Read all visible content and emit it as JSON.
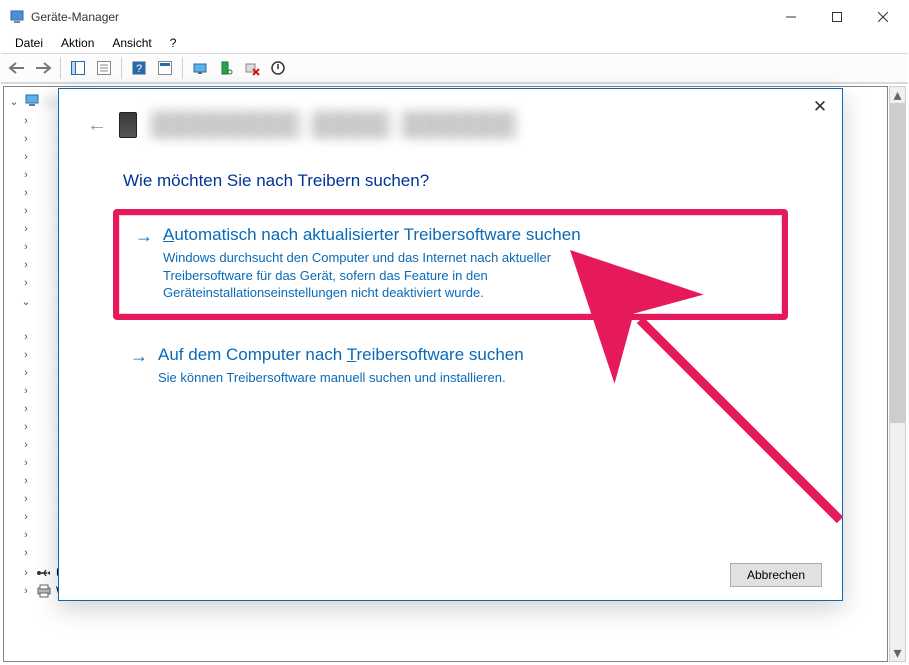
{
  "window": {
    "title": "Geräte-Manager",
    "menus": {
      "file": "Datei",
      "action": "Aktion",
      "view": "Ansicht",
      "help": "?"
    }
  },
  "tree": {
    "root_label": "",
    "visible_rows": [
      {
        "label": "USB-Controller"
      },
      {
        "label": "WSD-Druckanbieter"
      }
    ]
  },
  "dialog": {
    "question": "Wie möchten Sie nach Treibern suchen?",
    "option1": {
      "title_prefix": "A",
      "title_rest": "utomatisch nach aktualisierter Treibersoftware suchen",
      "desc": "Windows durchsucht den Computer und das Internet nach aktueller Treibersoftware für das Gerät, sofern das Feature in den Geräteinstallationseinstellungen nicht deaktiviert wurde."
    },
    "option2": {
      "title_pre": "Auf dem Computer nach ",
      "title_ul": "T",
      "title_post": "reibersoftware suchen",
      "desc": "Sie können Treibersoftware manuell suchen und installieren."
    },
    "cancel": "Abbrechen"
  }
}
